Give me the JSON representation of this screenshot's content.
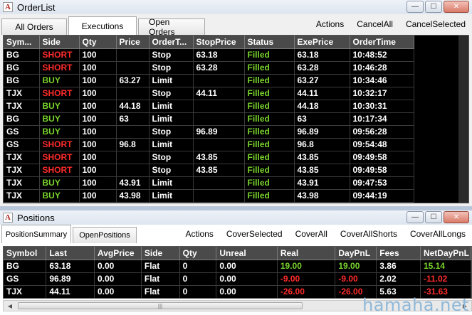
{
  "orderlist": {
    "title": "OrderList",
    "tabs": [
      "All Orders",
      "Executions",
      "Open Orders"
    ],
    "actions": [
      "Actions",
      "CancelAll",
      "CancelSelected"
    ],
    "columns": [
      "Sym...",
      "Side",
      "Qty",
      "Price",
      "OrderT...",
      "StopPrice",
      "Status",
      "ExePrice",
      "OrderTime"
    ],
    "rows": [
      [
        "BG",
        "SHORT",
        "100",
        "",
        "Stop",
        "63.18",
        "Filled",
        "63.18",
        "10:48:52"
      ],
      [
        "BG",
        "SHORT",
        "100",
        "",
        "Stop",
        "63.28",
        "Filled",
        "63.28",
        "10:46:28"
      ],
      [
        "BG",
        "BUY",
        "100",
        "63.27",
        "Limit",
        "",
        "Filled",
        "63.27",
        "10:34:46"
      ],
      [
        "TJX",
        "SHORT",
        "100",
        "",
        "Stop",
        "44.11",
        "Filled",
        "44.11",
        "10:32:17"
      ],
      [
        "TJX",
        "BUY",
        "100",
        "44.18",
        "Limit",
        "",
        "Filled",
        "44.18",
        "10:30:31"
      ],
      [
        "BG",
        "BUY",
        "100",
        "63",
        "Limit",
        "",
        "Filled",
        "63",
        "10:17:34"
      ],
      [
        "GS",
        "BUY",
        "100",
        "",
        "Stop",
        "96.89",
        "Filled",
        "96.89",
        "09:56:28"
      ],
      [
        "GS",
        "SHORT",
        "100",
        "96.8",
        "Limit",
        "",
        "Filled",
        "96.8",
        "09:54:48"
      ],
      [
        "TJX",
        "SHORT",
        "100",
        "",
        "Stop",
        "43.85",
        "Filled",
        "43.85",
        "09:49:58"
      ],
      [
        "TJX",
        "SHORT",
        "100",
        "",
        "Stop",
        "43.85",
        "Filled",
        "43.85",
        "09:49:58"
      ],
      [
        "TJX",
        "BUY",
        "100",
        "43.91",
        "Limit",
        "",
        "Filled",
        "43.91",
        "09:47:53"
      ],
      [
        "TJX",
        "BUY",
        "100",
        "43.98",
        "Limit",
        "",
        "Filled",
        "43.98",
        "09:44:19"
      ]
    ]
  },
  "positions": {
    "title": "Positions",
    "tabs": [
      "PositionSummary",
      "OpenPositions"
    ],
    "actions": [
      "Actions",
      "CoverSelected",
      "CoverAll",
      "CoverAllShorts",
      "CoverAllLongs"
    ],
    "columns": [
      "Symbol",
      "Last",
      "AvgPrice",
      "Side",
      "Qty",
      "Unreal",
      "Real",
      "DayPnL",
      "Fees",
      "NetDayPnL"
    ],
    "rows": [
      [
        "BG",
        "63.18",
        "0.00",
        "Flat",
        "0",
        "0.00",
        "19.00",
        "19.00",
        "3.86",
        "15.14"
      ],
      [
        "GS",
        "96.89",
        "0.00",
        "Flat",
        "0",
        "0.00",
        "-9.00",
        "-9.00",
        "2.02",
        "-11.02"
      ],
      [
        "TJX",
        "44.11",
        "0.00",
        "Flat",
        "0",
        "0.00",
        "-26.00",
        "-26.00",
        "5.63",
        "-31.63"
      ]
    ]
  },
  "window_controls": {
    "minimize": "—",
    "maximize": "☐",
    "close": "✕"
  },
  "app_icon_letter": "A",
  "scroll_grip": "|||",
  "watermark": "hamaha.net",
  "colors": {
    "short": "#ff2b2b",
    "buy": "#79d32c",
    "filled": "#79d32c",
    "grid_bg": "#000000",
    "header_bg": "#4a4a4a"
  }
}
